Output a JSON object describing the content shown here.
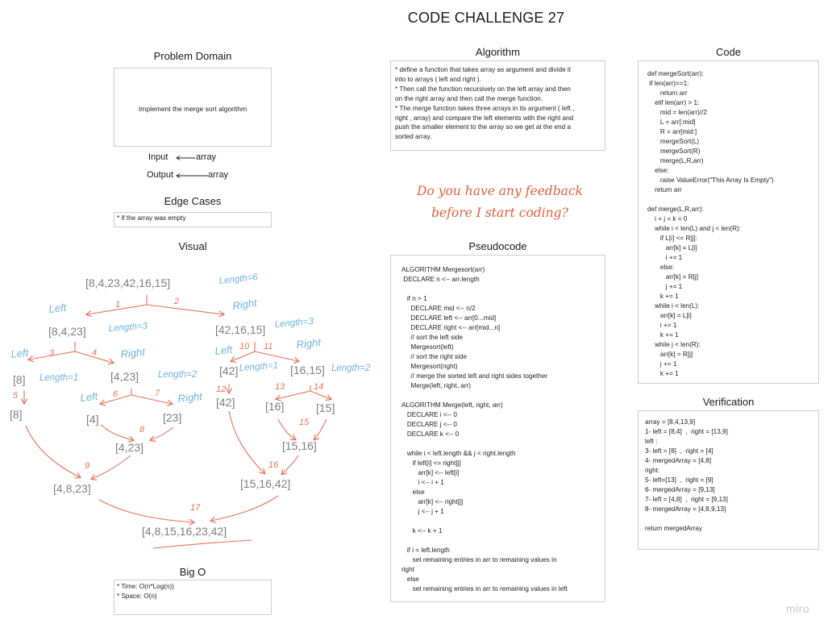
{
  "page_title": "CODE CHALLENGE 27",
  "problem_domain": {
    "heading": "Problem Domain",
    "text": "Implement the merge sort algorithm",
    "input_label": "Input",
    "input_value": "array",
    "output_label": "Output",
    "output_value": "array"
  },
  "edge_cases": {
    "heading": "Edge Cases",
    "text": "* if the array was empty"
  },
  "visual": {
    "heading": "Visual",
    "nodes": [
      "[8,4,23,42,16,15]",
      "[8,4,23]",
      "[42,16,15]",
      "[8]",
      "[4,23]",
      "[42]",
      "[16,15]",
      "[8]",
      "[4]",
      "[23]",
      "[42]",
      "[16]",
      "[15]",
      "[4,23]",
      "[15,16]",
      "[4,8,23]",
      "[15,16,42]",
      "[4,8,15,16,23,42]"
    ],
    "length_notes": [
      "Length=6",
      "Length=3",
      "Length=3",
      "Length=1",
      "Length=2",
      "Length=1",
      "Length=2"
    ],
    "side_labels": [
      "Left",
      "Right",
      "Left",
      "Right",
      "Left",
      "Right",
      "Left",
      "Right"
    ],
    "step_numbers": [
      "1",
      "2",
      "3",
      "4",
      "5",
      "6",
      "7",
      "8",
      "9",
      "10",
      "11",
      "12",
      "13",
      "14",
      "15",
      "16",
      "17"
    ],
    "colors": {
      "ink": "#888888",
      "blue": "#6fb3e0",
      "red": "#e8735a"
    }
  },
  "big_o": {
    "heading": "Big O",
    "lines": [
      "* Time: O(n*Log(n))",
      "* Space: O(n)"
    ]
  },
  "algorithm": {
    "heading": "Algorithm",
    "lines": [
      "* define a function that takes array as argument and divide it",
      "into to arrays ( left and right ).",
      "* Then call the function recursively on the left array and then",
      "on the right array and then call the merge function.",
      "* The merge function takes three arrays in its argument ( left ,",
      "right , array) and compare the left elements with the right and",
      "push the smaller element to the array so we get at the end a",
      "sorted array."
    ]
  },
  "feedback": {
    "line1": "Do you have any feedback",
    "line2": "before I start coding?",
    "color": "#e06040"
  },
  "pseudocode": {
    "heading": "Pseudocode",
    "lines": [
      "ALGORITHM Mergesort(arr)",
      " DECLARE n <-- arr.length",
      "",
      "   if n > 1",
      "     DECLARE mid <-- n/2",
      "     DECLARE left <-- arr[0...mid]",
      "     DECLARE right <-- arr[mid...n]",
      "     // sort the left side",
      "     Mergesort(left)",
      "     // sort the right side",
      "     Mergesort(right)",
      "     // merge the sorted left and right sides together",
      "     Merge(left, right, arr)",
      "",
      "ALGORITHM Merge(left, right, arr)",
      "   DECLARE i <-- 0",
      "   DECLARE j <-- 0",
      "   DECLARE k <-- 0",
      "",
      "   while i < left.length && j < right.length",
      "      if left[i] <= right[j]",
      "         arr[k] <-- left[i]",
      "         i <-- i + 1",
      "      else",
      "         arr[k] <-- right[j]",
      "         j <-- j + 1",
      "",
      "      k <-- k + 1",
      "",
      "   if i = left.length",
      "      set remaining entries in arr to remaining values in",
      "right",
      "   else",
      "      set remaining entries in arr to remaining values in left"
    ]
  },
  "code": {
    "heading": "Code",
    "lines": [
      "def mergeSort(arr):",
      " if len(arr)==1:",
      "       return arr",
      "    elif len(arr) > 1:",
      "       mid = len(arr)//2",
      "       L = arr[:mid]",
      "       R = arr[mid:]",
      "       mergeSort(L)",
      "       mergeSort(R)",
      "       merge(L,R,arr)",
      "    else:",
      "       raise ValueError(\"This Array Is Empty\")",
      "    return arr",
      "",
      "def merge(L,R,arr):",
      "    i = j = k = 0",
      "    while i < len(L) and j < len(R):",
      "       if L[i] <= R[j]:",
      "          arr[k] = L[i]",
      "          i += 1",
      "       else:",
      "          arr[k] = R[j]",
      "          j += 1",
      "       k += 1",
      "    while i < len(L):",
      "       arr[k] = L[i]",
      "       i += 1",
      "       k += 1",
      "    while j < len(R):",
      "       arr[k] = R[j]",
      "       j += 1",
      "       k += 1"
    ]
  },
  "verification": {
    "heading": "Verification",
    "lines": [
      "array = [8,4,13,9]",
      "1- left = [8,4]  ,  right = [13,9]",
      "left :",
      "3- left = [8]  ,  right = [4]",
      "4- mergedArray = [4,8]",
      "right:",
      "5- left=[13]  ,  right = [9]",
      "6- mergedArray = [9,13]",
      "7- left = [4,8]  ,  right = [9,13]",
      "8- mergedArray = [4,8,9,13]",
      "",
      "return mergedArray"
    ]
  },
  "watermark": "miro"
}
